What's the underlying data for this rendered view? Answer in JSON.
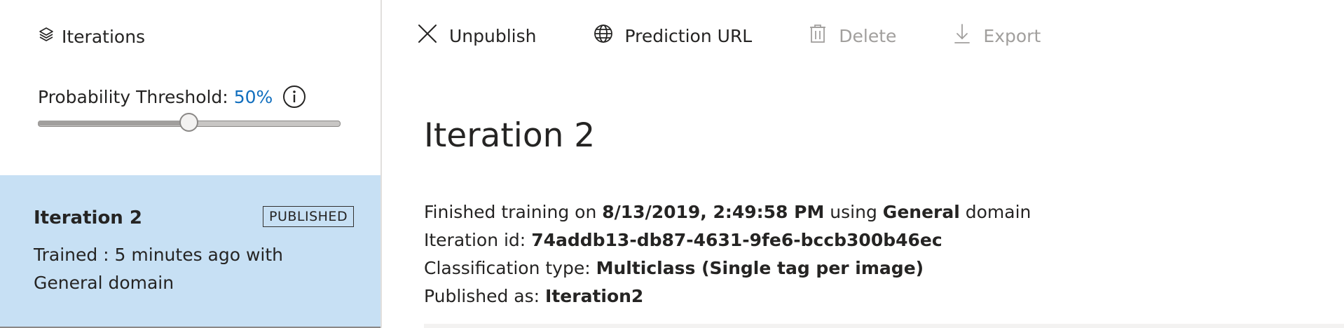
{
  "sidebar": {
    "header": {
      "icon": "layers-icon",
      "label": "Iterations"
    },
    "threshold": {
      "label": "Probability Threshold:",
      "value": "50%",
      "fraction": 0.5,
      "info_icon": "info-icon"
    },
    "iterations": [
      {
        "name": "Iteration 2",
        "badge": "PUBLISHED",
        "description": "Trained : 5 minutes ago with General domain"
      }
    ]
  },
  "toolbar": {
    "unpublish": {
      "label": "Unpublish",
      "icon": "close-icon"
    },
    "prediction_url": {
      "label": "Prediction URL",
      "icon": "globe-icon"
    },
    "delete": {
      "label": "Delete",
      "icon": "trash-icon"
    },
    "export": {
      "label": "Export",
      "icon": "download-icon"
    }
  },
  "main": {
    "title": "Iteration 2",
    "details": {
      "training_prefix": "Finished training on ",
      "training_date": "8/13/2019, 2:49:58 PM",
      "training_mid": " using ",
      "domain": "General",
      "training_suffix": " domain",
      "id_label": "Iteration id: ",
      "id_value": "74addb13-db87-4631-9fe6-bccb300b46ec",
      "classification_label": "Classification type: ",
      "classification_value": "Multiclass (Single tag per image)",
      "published_label": "Published as: ",
      "published_value": "Iteration2"
    }
  },
  "colors": {
    "accent": "#106ebe",
    "selected_bg": "#c7e0f4",
    "disabled": "#a19f9d"
  }
}
